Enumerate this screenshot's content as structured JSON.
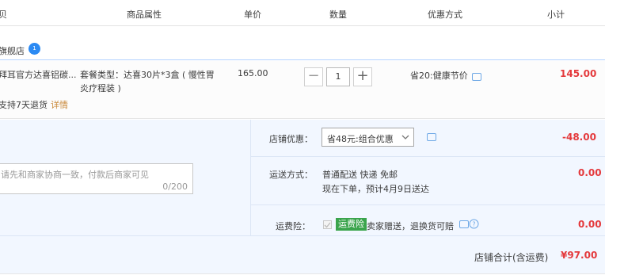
{
  "header": {
    "col_product": "贝",
    "col_attr": "商品属性",
    "col_price": "单价",
    "col_qty": "数量",
    "col_promo": "优惠方式",
    "col_subtotal": "小计"
  },
  "shop": {
    "name": "旗舰店",
    "badge": "1"
  },
  "item": {
    "title": "拜耳官方达喜铝碳...",
    "service": "支持7天退货",
    "service_link": "详情",
    "attr": "套餐类型：达喜30片*3盒 ( 慢性胃炎疗程装 )",
    "price": "165.00",
    "qty": "1",
    "minus": "−",
    "plus": "+",
    "promo": "省20:健康节价",
    "subtotal": "145.00"
  },
  "shop_discount": {
    "label": "店铺优惠：",
    "selected": "省48元:组合优惠",
    "amount": "-48.00"
  },
  "memo": {
    "placeholder": "请先和商家协商一致，付款后商家可见",
    "counter": "0/200"
  },
  "shipping": {
    "label": "运送方式：",
    "method": "普通配送 快递 免邮",
    "eta": "现在下单，预计4月9日送达",
    "amount": "0.00"
  },
  "insurance": {
    "label": "运费险：",
    "badge": "运费险",
    "desc": "卖家赠送，退换货可赔",
    "amount": "0.00"
  },
  "total": {
    "label": "店铺合计(含运费)",
    "amount": "¥97.00"
  },
  "colors": {
    "price_red": "#e4393c",
    "accent_blue": "#2b8af3",
    "panel_bg": "#f2f7ff",
    "insurance_green": "#3aa44c"
  }
}
